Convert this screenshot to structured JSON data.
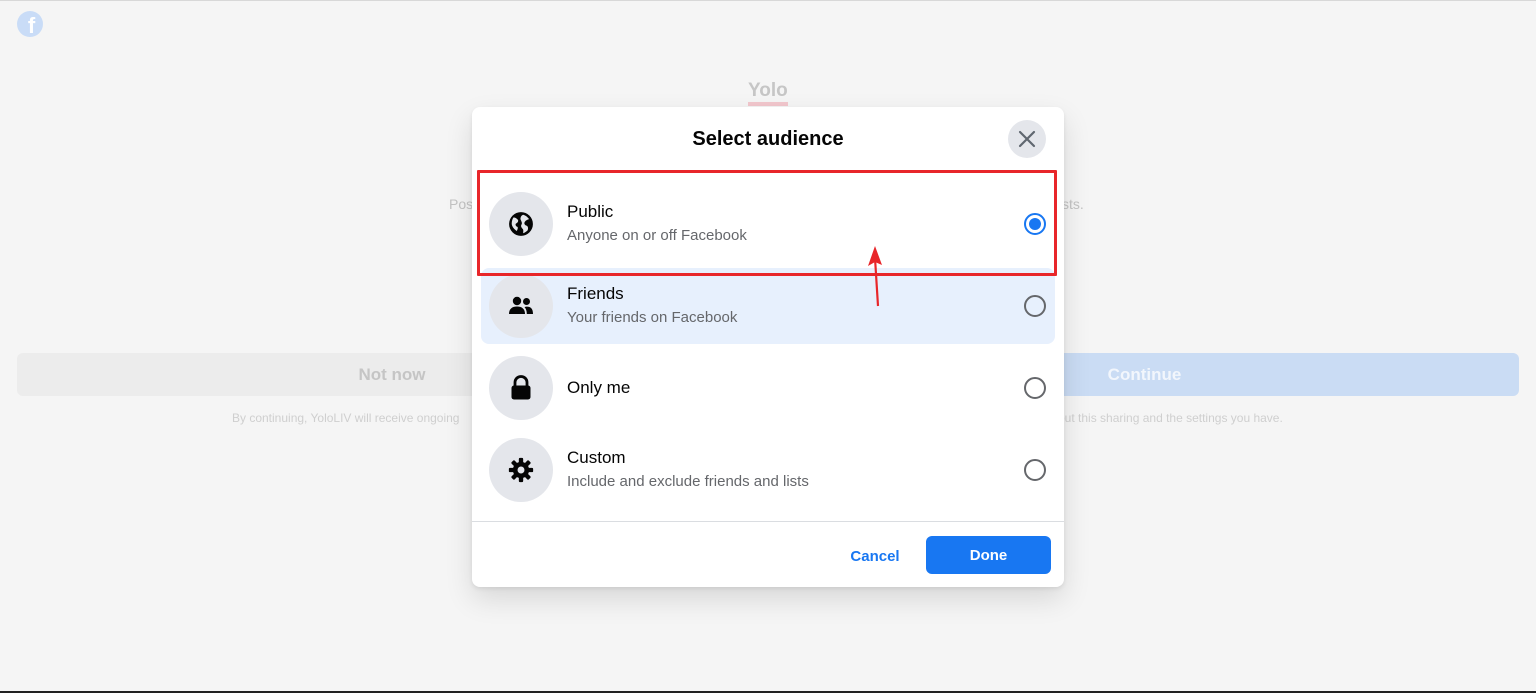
{
  "background": {
    "logo_letter": "f",
    "app_name": "Yolo",
    "description_left_fragment": "Pos",
    "description_right_fragment": "sts.",
    "not_now_label": "Not now",
    "continue_label": "Continue",
    "footer_left_fragment": "By continuing, YoloLIV will receive ongoing",
    "footer_right_fragment": "out this sharing and the settings you have."
  },
  "dialog": {
    "title": "Select audience",
    "close_icon": "close-icon",
    "options": [
      {
        "icon": "globe-icon",
        "title": "Public",
        "subtitle": "Anyone on or off Facebook",
        "selected": true
      },
      {
        "icon": "friends-icon",
        "title": "Friends",
        "subtitle": "Your friends on Facebook",
        "selected": false,
        "hovered": true
      },
      {
        "icon": "lock-icon",
        "title": "Only me",
        "subtitle": "",
        "selected": false
      },
      {
        "icon": "gear-icon",
        "title": "Custom",
        "subtitle": "Include and exclude friends and lists",
        "selected": false
      }
    ],
    "cancel_label": "Cancel",
    "done_label": "Done"
  },
  "colors": {
    "accent": "#1877f2",
    "highlight": "#e8262a",
    "hover_bg": "#e7f0fd"
  }
}
